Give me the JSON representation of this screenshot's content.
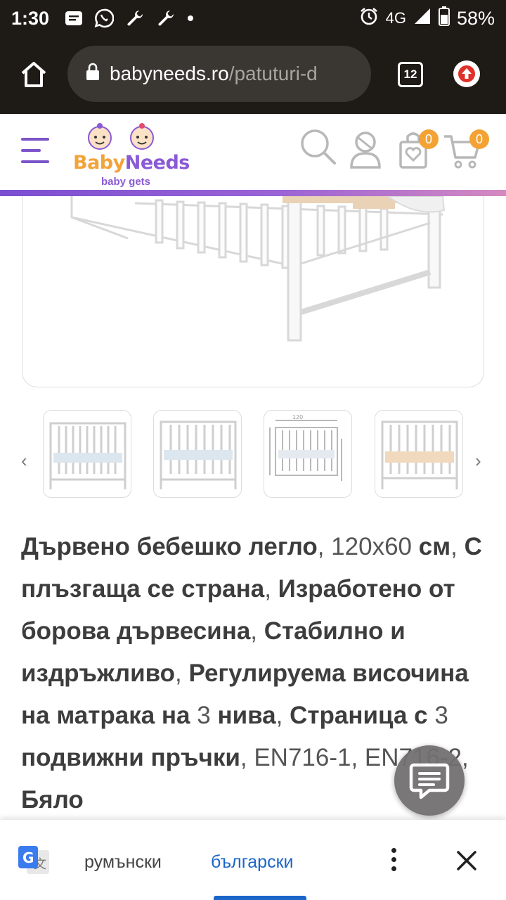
{
  "status_bar": {
    "time": "1:30",
    "network": "4G",
    "battery": "58%",
    "icons": [
      "message-icon",
      "viber-icon",
      "wrench-icon",
      "wrench-icon",
      "dot-icon",
      "alarm-icon",
      "signal-icon",
      "battery-icon"
    ]
  },
  "browser": {
    "url_host": "babyneeds.ro",
    "url_path": "/patuturi-d",
    "tab_count": "12"
  },
  "site_header": {
    "logo_text_a": "Baby",
    "logo_text_b": "Needs",
    "logo_tagline": "baby gets",
    "wishlist_count": "0",
    "cart_count": "0"
  },
  "gallery": {
    "prev_label": "‹",
    "next_label": "›",
    "thumb_count": 4
  },
  "description": {
    "segments": [
      {
        "t": "Дървено бебешко легло",
        "bold": true
      },
      {
        "t": ", 120x60",
        "bold": false
      },
      {
        "t": " см",
        "bold": true
      },
      {
        "t": ", ",
        "bold": false
      },
      {
        "t": "С плъзгаща се страна",
        "bold": true
      },
      {
        "t": ", ",
        "bold": false
      },
      {
        "t": "Изработено от борова дървесина",
        "bold": true
      },
      {
        "t": ", ",
        "bold": false
      },
      {
        "t": "Стабилно и издръжливо",
        "bold": true
      },
      {
        "t": ", ",
        "bold": false
      },
      {
        "t": "Регулируема височина на матрака на ",
        "bold": true
      },
      {
        "t": "3",
        "bold": false
      },
      {
        "t": " нива",
        "bold": true
      },
      {
        "t": ", ",
        "bold": false
      },
      {
        "t": "Страница с ",
        "bold": true
      },
      {
        "t": "3",
        "bold": false
      },
      {
        "t": " подвижни пръчки",
        "bold": true
      },
      {
        "t": ", EN716-1, EN716-2, ",
        "bold": false
      },
      {
        "t": "Бяло",
        "bold": true
      }
    ]
  },
  "translate_bar": {
    "lang_source": "румънски",
    "lang_target": "български",
    "accent_color": "#1a66c9"
  },
  "colors": {
    "brand_purple": "#7b54c9",
    "brand_orange": "#f3a233",
    "chrome_dark": "#1e1b17"
  }
}
